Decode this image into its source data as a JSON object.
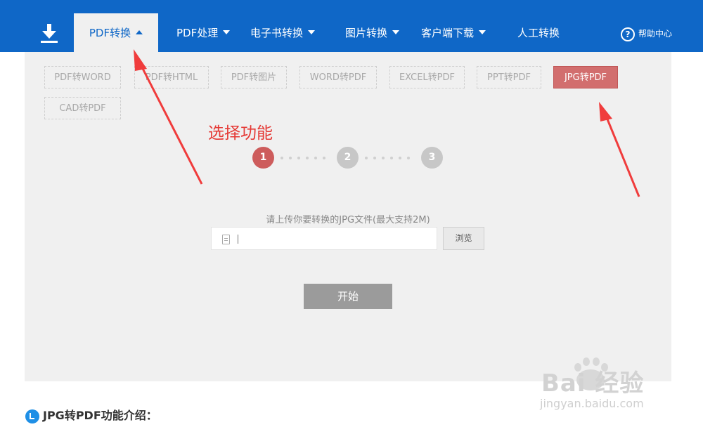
{
  "nav": {
    "items": [
      {
        "label": "PDF转换",
        "caret": "up",
        "active": true
      },
      {
        "label": "PDF处理",
        "caret": "down"
      },
      {
        "label": "电子书转换",
        "caret": "down"
      },
      {
        "label": "图片转换",
        "caret": "down"
      },
      {
        "label": "客户端下载",
        "caret": "down"
      },
      {
        "label": "人工转换"
      }
    ],
    "help": {
      "icon": "question-circle-icon",
      "glyph": "?",
      "label": "帮助中心"
    },
    "download_icon": "download-icon"
  },
  "options": [
    "PDF转WORD",
    "PDF转HTML",
    "PDF转图片",
    "WORD转PDF",
    "EXCEL转PDF",
    "PPT转PDF",
    "JPG转PDF",
    "CAD转PDF"
  ],
  "selected_option": "JPG转PDF",
  "annotation": "选择功能",
  "steps": [
    "1",
    "2",
    "3"
  ],
  "active_step": "1",
  "upload": {
    "hint": "请上传你要转换的JPG文件(最大支持2M)",
    "value": "",
    "browse_label": "浏览",
    "start_label": "开始"
  },
  "section_title": "JPG转PDF功能介绍：",
  "watermark": {
    "text": "Bai 经验",
    "url": "jingyan.baidu.com"
  },
  "colors": {
    "nav_bg": "#0f67c7",
    "panel_bg": "#f0f0f0",
    "selected_bg": "#d26e6e",
    "step_active": "#cd5c5c",
    "annotation": "#e53935"
  }
}
